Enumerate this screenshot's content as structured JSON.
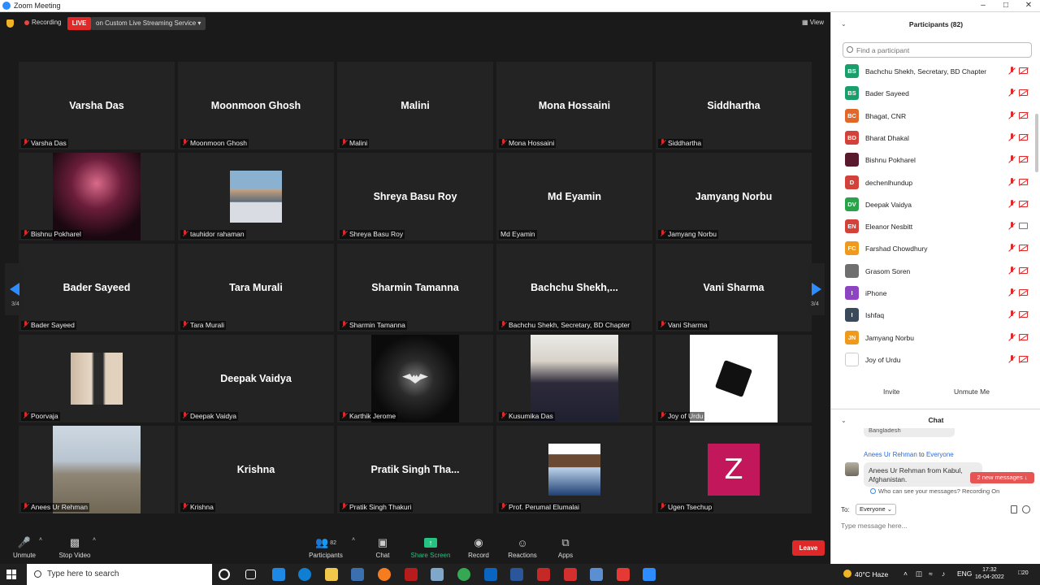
{
  "window": {
    "title": "Zoom Meeting"
  },
  "topbar": {
    "recording_label": "Recording",
    "live_label": "LIVE",
    "live_service": "on Custom Live Streaming Service",
    "view_label": "View"
  },
  "page_indicator": "3/4",
  "tiles": [
    {
      "label": "Varsha Das",
      "big": "Varsha Das",
      "mic_muted": true
    },
    {
      "label": "Moonmoon Ghosh",
      "big": "Moonmoon Ghosh",
      "mic_muted": true
    },
    {
      "label": "Malini",
      "big": "Malini",
      "mic_muted": true
    },
    {
      "label": "Mona Hossaini",
      "big": "Mona Hossaini",
      "mic_muted": true
    },
    {
      "label": "Siddhartha",
      "big": "Siddhartha",
      "mic_muted": true
    },
    {
      "label": "Bishnu Pokharel",
      "big": "",
      "photo": "ph-pokharel",
      "mic_muted": true
    },
    {
      "label": "tauhidor rahaman",
      "big": "",
      "photo": "ph-tauhidor",
      "mic_muted": true
    },
    {
      "label": "Shreya Basu Roy",
      "big": "Shreya Basu Roy",
      "mic_muted": true
    },
    {
      "label": "Md Eyamin",
      "big": "Md Eyamin",
      "mic_muted": false
    },
    {
      "label": "Jamyang Norbu",
      "big": "Jamyang Norbu",
      "mic_muted": true
    },
    {
      "label": "Bader Sayeed",
      "big": "Bader Sayeed",
      "mic_muted": true
    },
    {
      "label": "Tara Murali",
      "big": "Tara Murali",
      "mic_muted": true
    },
    {
      "label": "Sharmin Tamanna",
      "big": "Sharmin Tamanna",
      "mic_muted": true
    },
    {
      "label": "Bachchu Shekh, Secretary, BD Chapter",
      "big": "Bachchu  Shekh,...",
      "mic_muted": true
    },
    {
      "label": "Vani Sharma",
      "big": "Vani Sharma",
      "mic_muted": true
    },
    {
      "label": "Poorvaja",
      "big": "",
      "photo": "ph-poorvaja",
      "mic_muted": true
    },
    {
      "label": "Deepak Vaidya",
      "big": "Deepak Vaidya",
      "mic_muted": true
    },
    {
      "label": "Karthik Jerome",
      "big": "",
      "photo": "ph-karthik",
      "mic_muted": true
    },
    {
      "label": "Kusumika Das",
      "big": "",
      "photo": "ph-kusumika",
      "mic_muted": true
    },
    {
      "label": "Joy of Urdu",
      "big": "",
      "photo": "ph-joy",
      "mic_muted": true
    },
    {
      "label": "Anees Ur Rehman",
      "big": "",
      "photo": "ph-anees",
      "mic_muted": true
    },
    {
      "label": "Krishna",
      "big": "Krishna",
      "mic_muted": true
    },
    {
      "label": "Pratik Singh Thakuri",
      "big": "Pratik Singh Tha...",
      "mic_muted": true
    },
    {
      "label": "Prof. Perumal Elumalai",
      "big": "",
      "photo": "ph-perumal",
      "mic_muted": true
    },
    {
      "label": "Ugen Tsechup",
      "big": "",
      "photo": "ph-z",
      "initial": "Z",
      "mic_muted": true
    }
  ],
  "toolbar": {
    "unmute": "Unmute",
    "stop_video": "Stop Video",
    "participants": "Participants",
    "participants_count": "82",
    "chat": "Chat",
    "share_screen": "Share Screen",
    "record": "Record",
    "reactions": "Reactions",
    "apps": "Apps",
    "leave": "Leave"
  },
  "participants_panel": {
    "title": "Participants (82)",
    "search_placeholder": "Find a participant",
    "invite": "Invite",
    "unmute_me": "Unmute Me",
    "items": [
      {
        "initials": "BS",
        "name": "Bachchu Shekh, Secretary, BD Chapter",
        "color": "#1a9e6c",
        "video_on": false
      },
      {
        "initials": "BS",
        "name": "Bader Sayeed",
        "color": "#1a9e6c",
        "video_on": false
      },
      {
        "initials": "BC",
        "name": "Bhagat, CNR",
        "color": "#e0682a",
        "video_on": false
      },
      {
        "initials": "BD",
        "name": "Bharat Dhakal",
        "color": "#d2413a",
        "video_on": false
      },
      {
        "initials": "",
        "name": "Bishnu Pokharel",
        "color": "#5a1a2e",
        "video_on": false
      },
      {
        "initials": "D",
        "name": "dechenlhundup",
        "color": "#d2413a",
        "video_on": false
      },
      {
        "initials": "DV",
        "name": "Deepak Vaidya",
        "color": "#29a34a",
        "video_on": false
      },
      {
        "initials": "EN",
        "name": "Eleanor Nesbitt",
        "color": "#d2413a",
        "video_on": true
      },
      {
        "initials": "FC",
        "name": "Farshad Chowdhury",
        "color": "#f09a1d",
        "video_on": false
      },
      {
        "initials": "",
        "name": "Grasom Soren",
        "color": "#6f6f6f",
        "video_on": false
      },
      {
        "initials": "I",
        "name": "iPhone",
        "color": "#8e44c2",
        "video_on": false
      },
      {
        "initials": "I",
        "name": "Ishfaq",
        "color": "#3a4a5a",
        "video_on": false
      },
      {
        "initials": "JN",
        "name": "Jamyang Norbu",
        "color": "#f09a1d",
        "video_on": false
      },
      {
        "initials": "",
        "name": "Joy of Urdu",
        "color": "#ffffff",
        "video_on": false
      }
    ]
  },
  "chat": {
    "title": "Chat",
    "prev_bubble": "Bangladesh",
    "sender": "Anees Ur Rehman",
    "to_word": "to",
    "recipient": "Everyone",
    "message": "Anees Ur Rehman from Kabul, Afghanistan.",
    "new_messages": "2 new messages",
    "who_can_see": "Who can see your messages? Recording On",
    "to_label": "To:",
    "to_value": "Everyone",
    "input_placeholder": "Type message here..."
  },
  "taskbar": {
    "search_placeholder": "Type here to search",
    "weather": "40°C Haze",
    "lang": "ENG",
    "time": "17:32",
    "date": "16-04-2022",
    "notif_count": "20"
  }
}
